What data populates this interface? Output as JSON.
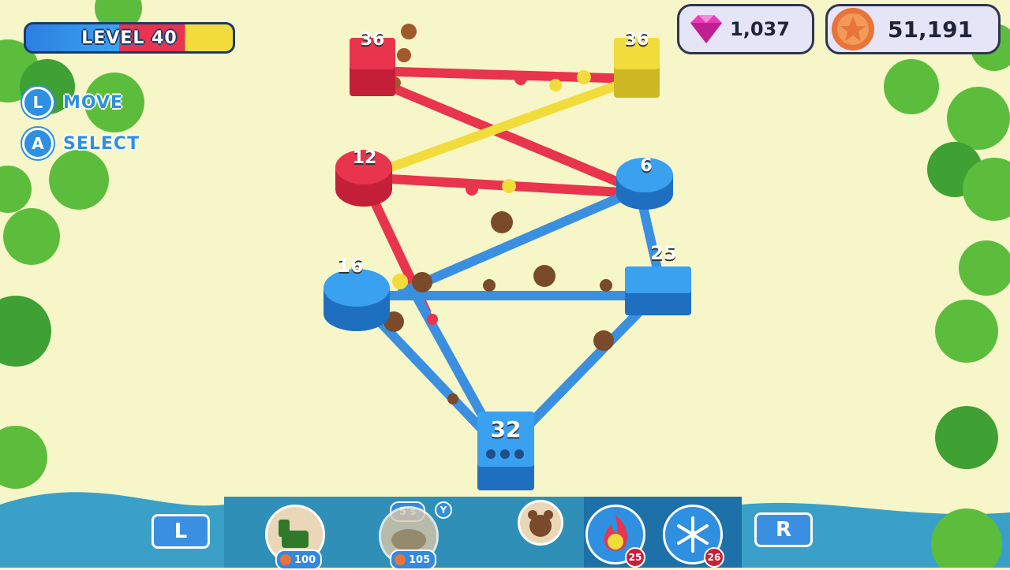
{
  "hud": {
    "level_label": "LEVEL 40",
    "gems": "1,037",
    "coins": "51,191",
    "controls": [
      {
        "button": "L",
        "label": "MOVE"
      },
      {
        "button": "A",
        "label": "SELECT"
      }
    ]
  },
  "towers": {
    "red_top": "36",
    "yellow_top": "36",
    "red_mid": "12",
    "blue_right": "6",
    "blue_left": "16",
    "blue_mid_right": "25",
    "blue_bottom": "32"
  },
  "bottom_bar": {
    "shoulder_left": "L",
    "shoulder_right": "R",
    "unit1_price": "100",
    "unit2_timer": "5 s",
    "unit2_button": "Y",
    "unit2_price": "105",
    "fire_count": "25",
    "freeze_count": "26",
    "icons": [
      "cannon-unit-icon",
      "log-unit-icon",
      "bear-unit-icon",
      "fire-power-icon",
      "snowflake-power-icon"
    ]
  },
  "colors": {
    "red_team": "#e8344d",
    "yellow_team": "#f2dc3c",
    "blue_team": "#2f8fe0"
  }
}
